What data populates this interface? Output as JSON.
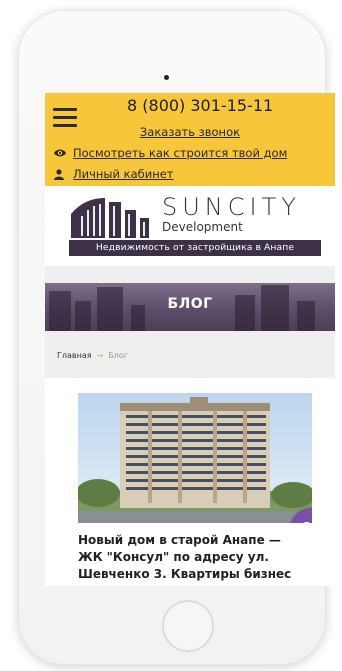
{
  "header": {
    "phone": "8 (800) 301-15-11",
    "callback_label": "Заказать звонок",
    "watch_link": "Посмотреть как строится твой дом",
    "cabinet_link": "Личный кабинет"
  },
  "logo": {
    "name": "SUNCITY",
    "sub": "Development",
    "tagline": "Недвижимость от застройщика в Анапе"
  },
  "banner": {
    "title": "БЛОГ"
  },
  "breadcrumb": {
    "home": "Главная",
    "separator": "→",
    "current": "Блог"
  },
  "article": {
    "title": "Новый дом в старой Анапе — ЖК \"Консул\" по адресу ул. Шевченко 3. Квартиры бизнес класса с"
  },
  "colors": {
    "topbar": "#f7c63b",
    "brand": "#3c3147",
    "viber": "#7a4fa8"
  },
  "icons": [
    "menu-icon",
    "eye-icon",
    "person-icon",
    "viber-phone-icon"
  ]
}
